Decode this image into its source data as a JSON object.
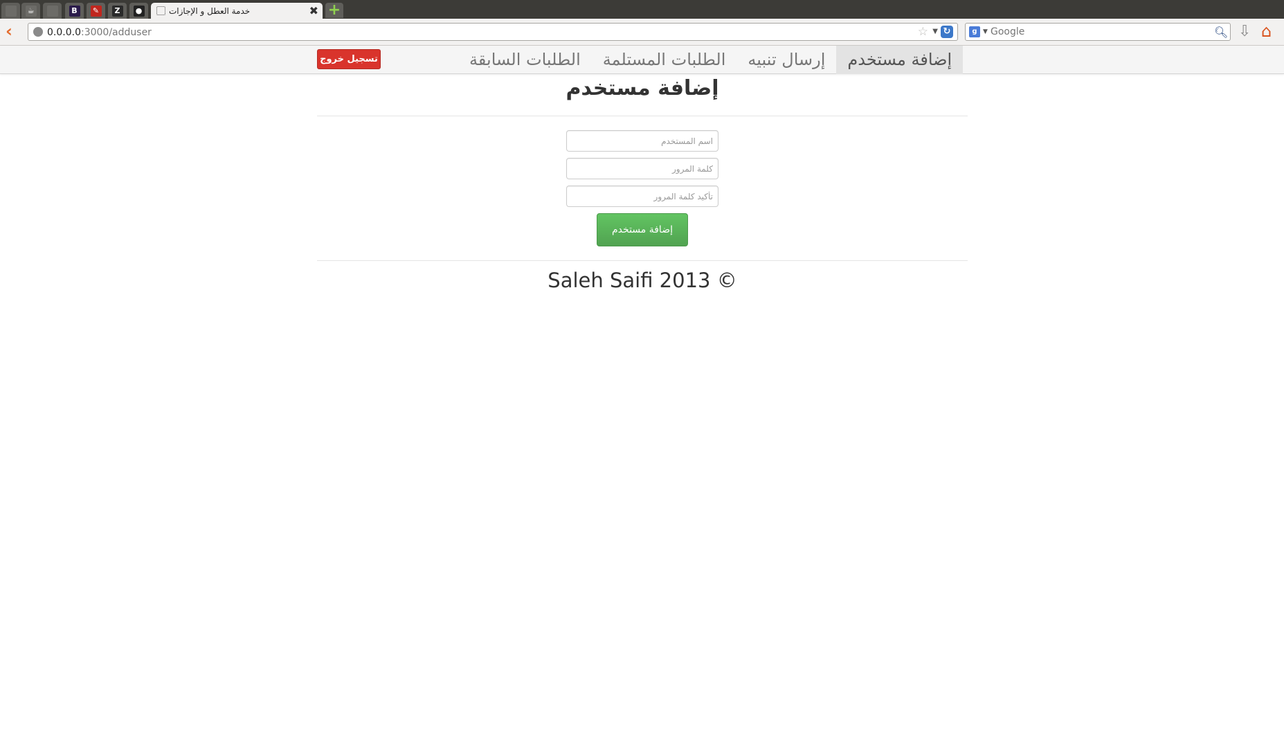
{
  "browser": {
    "pinned_tabs": [
      {
        "glyph": "",
        "color": "#6c6b67"
      },
      {
        "glyph": "☕",
        "color": "#6c6b67"
      },
      {
        "glyph": "",
        "color": "#6c6b67"
      },
      {
        "glyph": "B",
        "color": "#2b1b4a"
      },
      {
        "glyph": "✎",
        "color": "#c0261e"
      },
      {
        "glyph": "Z",
        "color": "#2a2a2a"
      },
      {
        "glyph": "●",
        "color": "#222222"
      }
    ],
    "active_tab_title": "خدمة العطل و الإجازات",
    "tab_close_glyph": "✖",
    "new_tab_glyph": "+",
    "url_host": "0.0.0.0",
    "url_path": ":3000/adduser",
    "search_placeholder": "Google",
    "search_engine_glyph": "g"
  },
  "nav": {
    "logout_label": "تسجيل خروج",
    "links": [
      {
        "label": "الطلبات السابقة",
        "active": false
      },
      {
        "label": "الطلبات المستلمة",
        "active": false
      },
      {
        "label": "إرسال تنبيه",
        "active": false
      },
      {
        "label": "إضافة مستخدم",
        "active": true
      }
    ]
  },
  "form": {
    "title": "إضافة مستخدم",
    "username_placeholder": "اسم المستخدم",
    "password_placeholder": "كلمة المرور",
    "confirm_password_placeholder": "تأكيد كلمة المرور",
    "submit_label": "إضافة مستخدم"
  },
  "footer": {
    "text": "Saleh Saifi 2013 ©"
  },
  "colors": {
    "logout": "#d9342c",
    "submit": "#5cb85c",
    "active_nav_bg": "#e3e3e3"
  }
}
